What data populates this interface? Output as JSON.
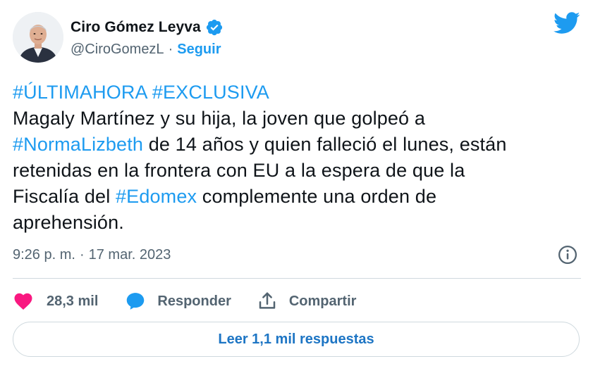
{
  "author": {
    "name": "Ciro Gómez Leyva",
    "handle": "@CiroGomezL",
    "separator": "·",
    "follow_label": "Seguir"
  },
  "tweet": {
    "lines": [
      [
        {
          "t": "#ÚLTIMAHORA #EXCLUSIVA",
          "tag": true
        }
      ],
      [
        {
          "t": "Magaly Martínez y su hija, la joven que golpeó a",
          "tag": false
        }
      ],
      [
        {
          "t": "#NormaLizbeth",
          "tag": true
        },
        {
          "t": " de 14 años y quien falleció el lunes, están",
          "tag": false
        }
      ],
      [
        {
          "t": "retenidas en la frontera con EU a la espera de que la",
          "tag": false
        }
      ],
      [
        {
          "t": "Fiscalía del ",
          "tag": false
        },
        {
          "t": "#Edomex",
          "tag": true
        },
        {
          "t": " complemente una orden de",
          "tag": false
        }
      ],
      [
        {
          "t": "aprehensión.",
          "tag": false
        }
      ]
    ]
  },
  "meta": {
    "time": "9:26 p. m.",
    "separator": "·",
    "date": "17 mar. 2023"
  },
  "actions": {
    "likes": "28,3 mil",
    "reply_label": "Responder",
    "share_label": "Compartir"
  },
  "replies_button": "Leer 1,1 mil respuestas",
  "colors": {
    "accent": "#1d9bf0",
    "like": "#f91880",
    "text": "#0f1419",
    "muted": "#536471",
    "border": "#cfd9de"
  },
  "icons": [
    "verified-badge-icon",
    "twitter-bird-icon",
    "info-icon",
    "heart-icon",
    "reply-bubble-icon",
    "share-icon"
  ]
}
